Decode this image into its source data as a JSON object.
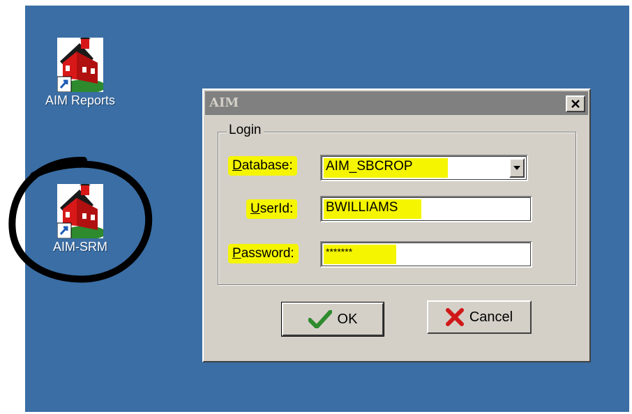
{
  "desktop": {
    "background": "#3a6ea5",
    "icons": [
      {
        "label": "AIM Reports",
        "icon": "schoolhouse-shortcut-icon"
      },
      {
        "label": "AIM-SRM",
        "icon": "schoolhouse-shortcut-icon",
        "circled": true
      }
    ]
  },
  "dialog": {
    "title": "AIM",
    "group_label": "Login",
    "database": {
      "label_prefix": "D",
      "label_rest": "atabase:",
      "value": "AIM_SBCROP"
    },
    "userid": {
      "label_prefix": "U",
      "label_rest": "serId:",
      "value": "BWILLIAMS"
    },
    "password": {
      "label_prefix": "P",
      "label_rest": "assword:",
      "value": "*******"
    },
    "ok_label": "OK",
    "cancel_label": "Cancel",
    "highlight_color": "#f5f500"
  }
}
